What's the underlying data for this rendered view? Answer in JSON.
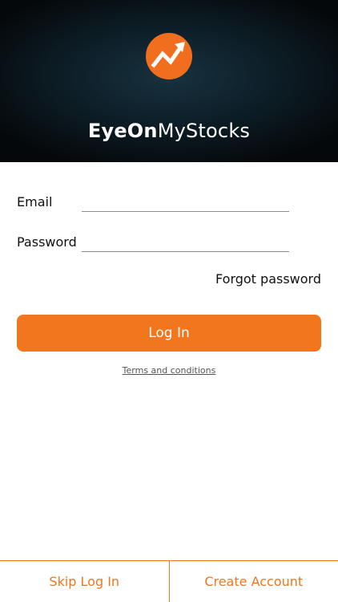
{
  "brand": {
    "name_bold": "EyeOn",
    "name_light": "MyStocks",
    "logo_icon": "trending-up-arrow-icon",
    "accent_color": "#f2761d"
  },
  "form": {
    "email_label": "Email",
    "email_value": "",
    "password_label": "Password",
    "password_value": "",
    "forgot_label": "Forgot password",
    "login_label": "Log In",
    "terms_label": "Terms and conditions"
  },
  "footer": {
    "skip_label": "Skip Log In",
    "create_label": "Create Account"
  }
}
